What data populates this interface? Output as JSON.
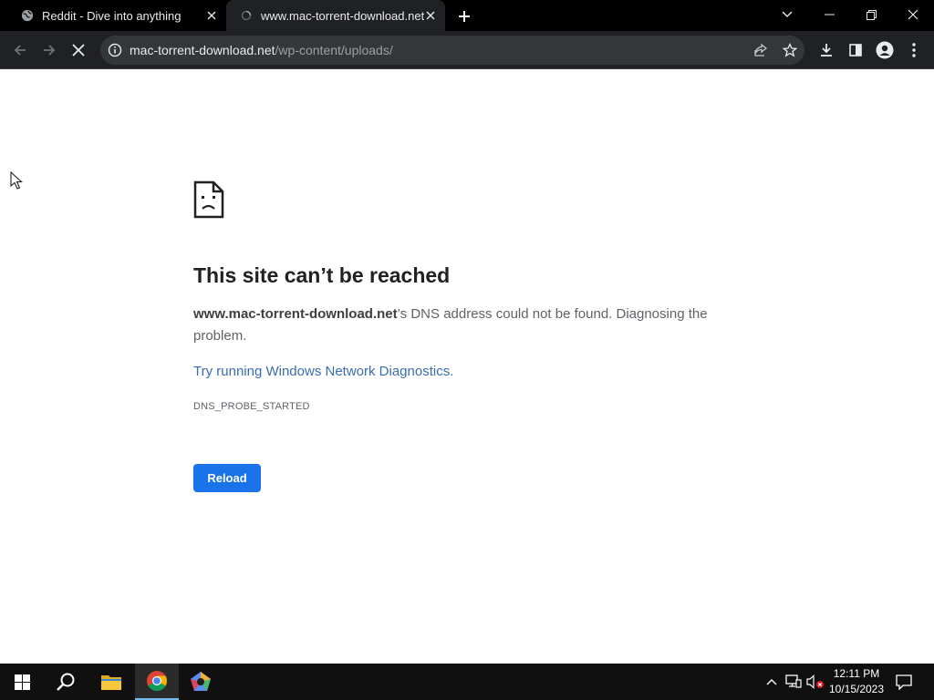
{
  "tabs": [
    {
      "title": "Reddit - Dive into anything",
      "favicon": "globe-icon"
    },
    {
      "title": "www.mac-torrent-download.net",
      "favicon": "loading-icon",
      "active": true
    }
  ],
  "omnibox": {
    "host": "mac-torrent-download.net",
    "path": "/wp-content/uploads/"
  },
  "error": {
    "title": "This site can’t be reached",
    "host": "www.mac-torrent-download.net",
    "desc_rest": "’s DNS address could not be found. Diagnosing the problem.",
    "link": "Try running Windows Network Diagnostics",
    "link_suffix": ".",
    "code": "DNS_PROBE_STARTED",
    "reload_label": "Reload"
  },
  "taskbar": {
    "time": "12:11 PM",
    "date": "10/15/2023"
  },
  "colors": {
    "accent": "#1a73e8",
    "link": "#3a6db0",
    "chrome_dark": "#202124"
  }
}
